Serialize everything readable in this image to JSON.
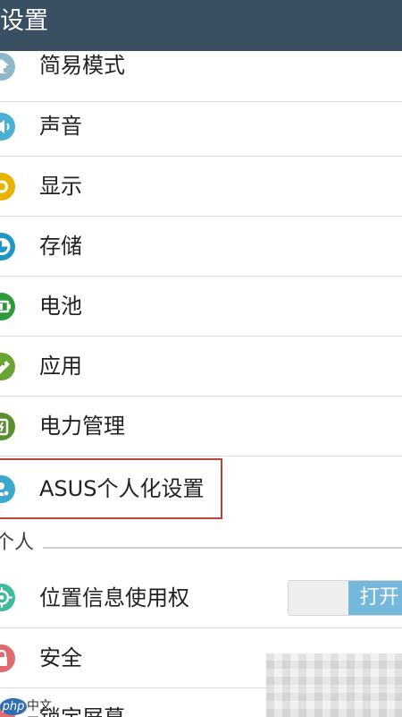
{
  "titlebar": {
    "title": "设置"
  },
  "items": [
    {
      "label": "简易模式",
      "icon": "home-icon",
      "color": "#8fb9c8"
    },
    {
      "label": "声音",
      "icon": "speaker-icon",
      "color": "#4ab0d4"
    },
    {
      "label": "显示",
      "icon": "brightness-icon",
      "color": "#e8b400"
    },
    {
      "label": "存储",
      "icon": "storage-icon",
      "color": "#2196c4"
    },
    {
      "label": "电池",
      "icon": "battery-icon",
      "color": "#2e9b3a"
    },
    {
      "label": "应用",
      "icon": "android-icon",
      "color": "#6aa432"
    },
    {
      "label": "电力管理",
      "icon": "power-management-icon",
      "color": "#5a8f2e"
    },
    {
      "label": "ASUS个人化设置",
      "icon": "personalization-icon",
      "color": "#3aa9cc"
    }
  ],
  "section": {
    "label": "个人"
  },
  "personal_items": [
    {
      "label": "位置信息使用权",
      "icon": "location-icon",
      "color": "#3dbb9a"
    },
    {
      "label": "安全",
      "icon": "lock-icon",
      "color": "#e06a70"
    },
    {
      "label": "锁定屏幕",
      "icon": "lockscreen-icon",
      "color": "#e06a70"
    }
  ],
  "location_toggle": {
    "on_label": "打开"
  },
  "watermark": {
    "badge": "php",
    "text": "中文网"
  }
}
